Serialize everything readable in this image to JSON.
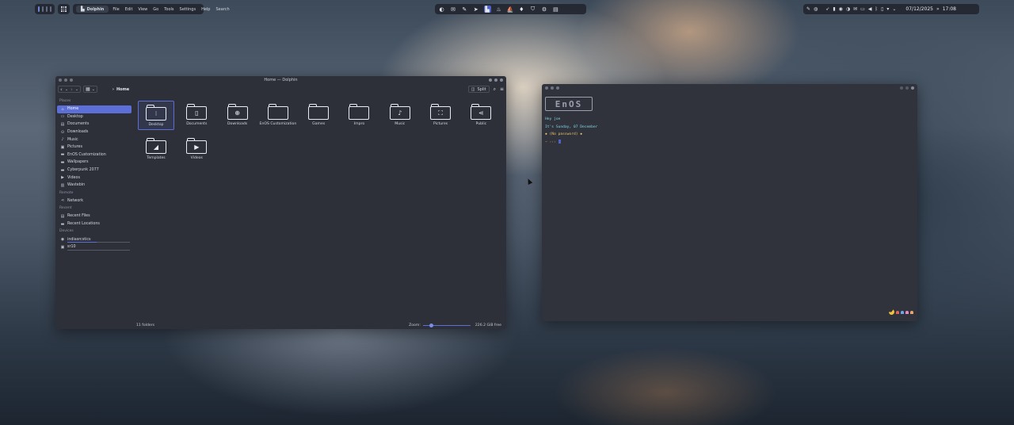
{
  "top_panel": {
    "app_name": "Dolphin",
    "menu": [
      "File",
      "Edit",
      "View",
      "Go",
      "Tools",
      "Settings",
      "Help",
      "Search"
    ],
    "date": "07/12/2025",
    "time": "17:08"
  },
  "dolphin": {
    "window_title": "Home — Dolphin",
    "breadcrumb": "Home",
    "split_label": "Split",
    "sidebar": {
      "places_title": "Places",
      "places": [
        "Home",
        "Desktop",
        "Documents",
        "Downloads",
        "Music",
        "Pictures",
        "EnOS Customization",
        "Wallpapers",
        "Cyberpunk 2077",
        "Videos",
        "Wastebin"
      ],
      "remote_title": "Remote",
      "remote": [
        "Network"
      ],
      "recent_title": "Recent",
      "recent": [
        "Recent Files",
        "Recent Locations"
      ],
      "devices_title": "Devices",
      "devices": [
        "indiasrcstics",
        "sr10"
      ]
    },
    "folders": [
      "Desktop",
      "Documents",
      "Downloads",
      "EnOS Customization",
      "Games",
      "Impro",
      "Music",
      "Pictures",
      "Public",
      "Templates",
      "Videos"
    ],
    "status": {
      "count": "11 folders",
      "zoom_label": "Zoom:",
      "free_space": "226.2 GiB free"
    }
  },
  "terminal": {
    "ascii_logo": "EnOS",
    "greeting": "Hey joe",
    "date_line": "It's Sunday, 07 December",
    "session_line": "◆ (No password) ◆",
    "prompt": "~ ›››"
  },
  "colors": {
    "accent": "#5b6fd6",
    "window_bg": "#2d3039",
    "panel_bg": "#22262f"
  }
}
